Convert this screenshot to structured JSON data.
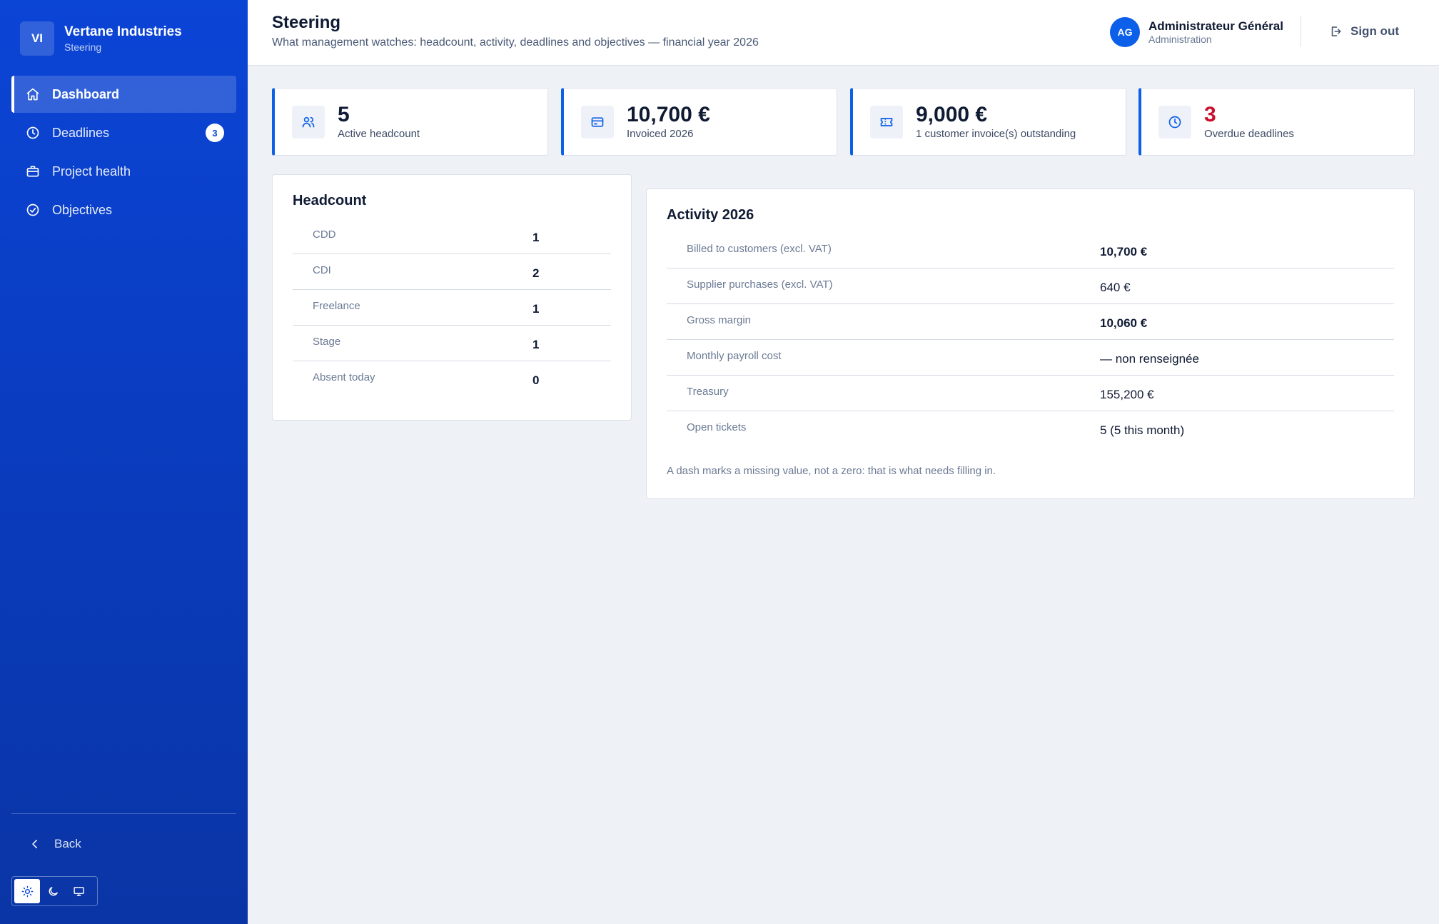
{
  "brand": {
    "initials": "VI",
    "name": "Vertane Industries",
    "subtitle": "Steering"
  },
  "nav": [
    {
      "label": "Dashboard",
      "icon": "home-icon",
      "active": true
    },
    {
      "label": "Deadlines",
      "icon": "clock-icon",
      "badge": "3"
    },
    {
      "label": "Project health",
      "icon": "briefcase-icon"
    },
    {
      "label": "Objectives",
      "icon": "check-circle-icon"
    }
  ],
  "sidebar_footer": {
    "back_label": "Back",
    "theme_options": [
      "sun-icon",
      "moon-icon",
      "monitor-icon"
    ],
    "theme_selected": "light"
  },
  "header": {
    "title": "Steering",
    "subtitle": "What management watches: headcount, activity, deadlines and objectives — financial year 2026",
    "user": {
      "initials": "AG",
      "name": "Administrateur Général",
      "role": "Administration"
    },
    "signout_label": "Sign out"
  },
  "stats": [
    {
      "value": "5",
      "label": "Active headcount",
      "icon": "users-icon"
    },
    {
      "value": "10,700 €",
      "label": "Invoiced 2026",
      "icon": "card-icon"
    },
    {
      "value": "9,000 €",
      "label": "1 customer invoice(s) outstanding",
      "icon": "ticket-icon"
    },
    {
      "value": "3",
      "label": "Overdue deadlines",
      "icon": "clock-icon",
      "alert": true
    }
  ],
  "headcount": {
    "title": "Headcount",
    "rows": [
      {
        "label": "CDD",
        "value": "1"
      },
      {
        "label": "CDI",
        "value": "2"
      },
      {
        "label": "Freelance",
        "value": "1"
      },
      {
        "label": "Stage",
        "value": "1"
      },
      {
        "label": "Absent today",
        "value": "0"
      }
    ]
  },
  "activity": {
    "title": "Activity 2026",
    "rows": [
      {
        "label": "Billed to customers (excl. VAT)",
        "value": "10,700 €",
        "bold": true
      },
      {
        "label": "Supplier purchases (excl. VAT)",
        "value": "640 €"
      },
      {
        "label": "Gross margin",
        "value": "10,060 €",
        "bold": true
      },
      {
        "label": "Monthly payroll cost",
        "value": "— non renseignée"
      },
      {
        "label": "Treasury",
        "value": "155,200 €"
      },
      {
        "label": "Open tickets",
        "value": "5 (5 this month)"
      }
    ],
    "note": "A dash marks a missing value, not a zero: that is what needs filling in."
  },
  "colors": {
    "sidebar": "#0b45d6",
    "accent": "#0b5fe8",
    "alert": "#c8102e",
    "background": "#eef1f6"
  }
}
